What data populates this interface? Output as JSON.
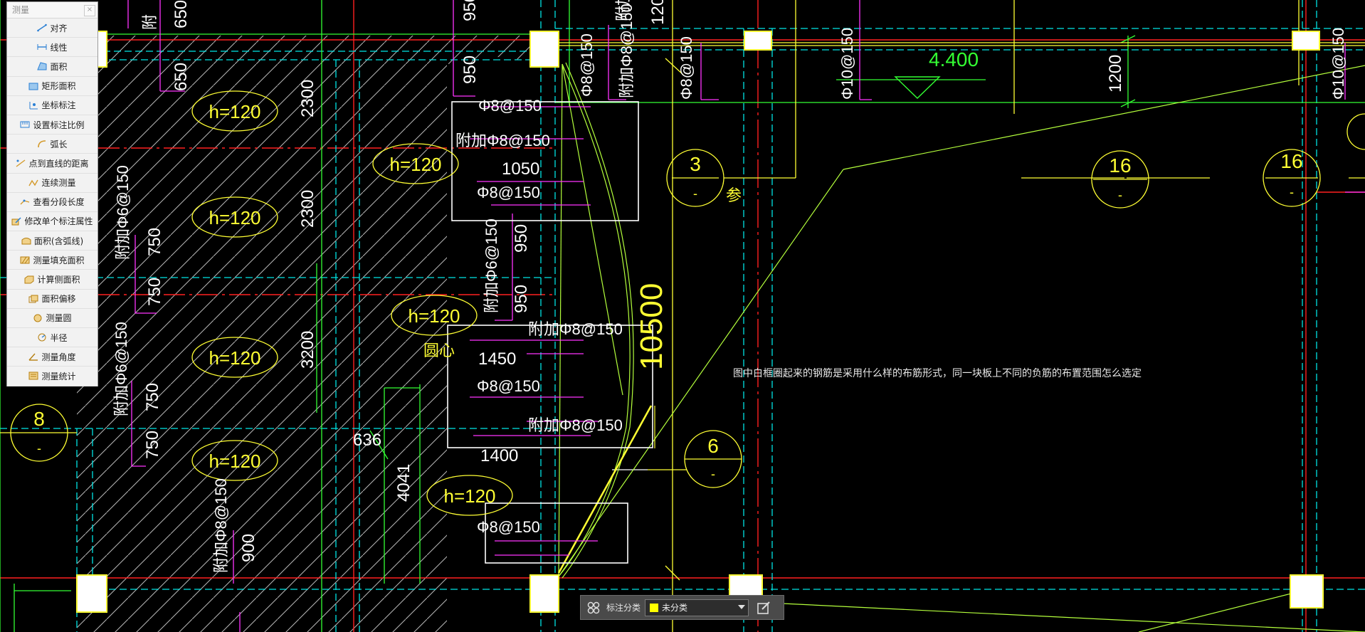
{
  "panel": {
    "title": "测量",
    "close_glyph": "×",
    "items": [
      {
        "label": "对齐",
        "icon": "align-dimension-icon"
      },
      {
        "label": "线性",
        "icon": "linear-dimension-icon"
      },
      {
        "label": "面积",
        "icon": "area-icon"
      },
      {
        "label": "矩形面积",
        "icon": "rectangle-area-icon"
      },
      {
        "label": "坐标标注",
        "icon": "coordinate-icon"
      },
      {
        "label": "设置标注比例",
        "icon": "scale-icon"
      },
      {
        "label": "弧长",
        "icon": "arc-length-icon"
      },
      {
        "label": "点到直线的距离",
        "icon": "point-line-distance-icon"
      },
      {
        "label": "连续测量",
        "icon": "continuous-measure-icon"
      },
      {
        "label": "查看分段长度",
        "icon": "segment-length-icon"
      },
      {
        "label": "修改单个标注属性",
        "icon": "edit-dimension-icon"
      },
      {
        "label": "面积(含弧线)",
        "icon": "arc-area-icon"
      },
      {
        "label": "测量填充面积",
        "icon": "hatch-area-icon"
      },
      {
        "label": "计算侧面积",
        "icon": "side-area-icon"
      },
      {
        "label": "面积偏移",
        "icon": "area-offset-icon"
      },
      {
        "label": "测量圆",
        "icon": "circle-measure-icon"
      },
      {
        "label": "半径",
        "icon": "radius-icon"
      },
      {
        "label": "测量角度",
        "icon": "angle-icon"
      },
      {
        "label": "测量统计",
        "icon": "statistics-icon"
      }
    ]
  },
  "note": "图中白框圈起来的钢筋是采用什么样的布筋形式，同一块板上不同的负筋的布置范围怎么选定",
  "bar": {
    "label": "标注分类",
    "selected": "未分类",
    "swatch_color": "#ffff00"
  },
  "drawing": {
    "colors": {
      "yellow": "#ffff33",
      "magenta": "#ff33ff",
      "green": "#33ff33",
      "cyan": "#00e5e5",
      "red": "#ff2020",
      "white": "#ffffff",
      "lime": "#b4ff3c"
    },
    "slab_labels": [
      "h=120",
      "h=120",
      "h=120",
      "h=120",
      "h=120",
      "h=120",
      "h=120"
    ],
    "grid_marks": [
      {
        "num": "3",
        "sub": "-"
      },
      {
        "num": "16",
        "sub": "-"
      },
      {
        "num": "16",
        "sub": "-"
      },
      {
        "num": "8",
        "sub": "-"
      },
      {
        "num": "6",
        "sub": "-"
      }
    ],
    "elevation": "4.400",
    "big_dim": "10500",
    "dims": [
      "650",
      "650",
      "950",
      "950",
      "2300",
      "2300",
      "3200",
      "1200",
      "1200",
      "1050",
      "950",
      "950",
      "750",
      "750",
      "750",
      "750",
      "1450",
      "1400",
      "636",
      "4041",
      "900"
    ],
    "rebar_labels": [
      "Φ8@150",
      "附加Φ8@150",
      "Φ8@150",
      "Φ8@150",
      "附加Φ8@150",
      "Φ8@150",
      "附加Φ8@150",
      "Φ8@150",
      "Φ8@150",
      "附加Φ8@150",
      "附加Φ8@150",
      "Φ10@150",
      "Φ10@150",
      "附加Φ6@150",
      "附加Φ6@150",
      "附加Φ6@150",
      "附加Φ8@150",
      "附"
    ],
    "misc_labels": [
      "参",
      "圆心",
      "附"
    ]
  }
}
